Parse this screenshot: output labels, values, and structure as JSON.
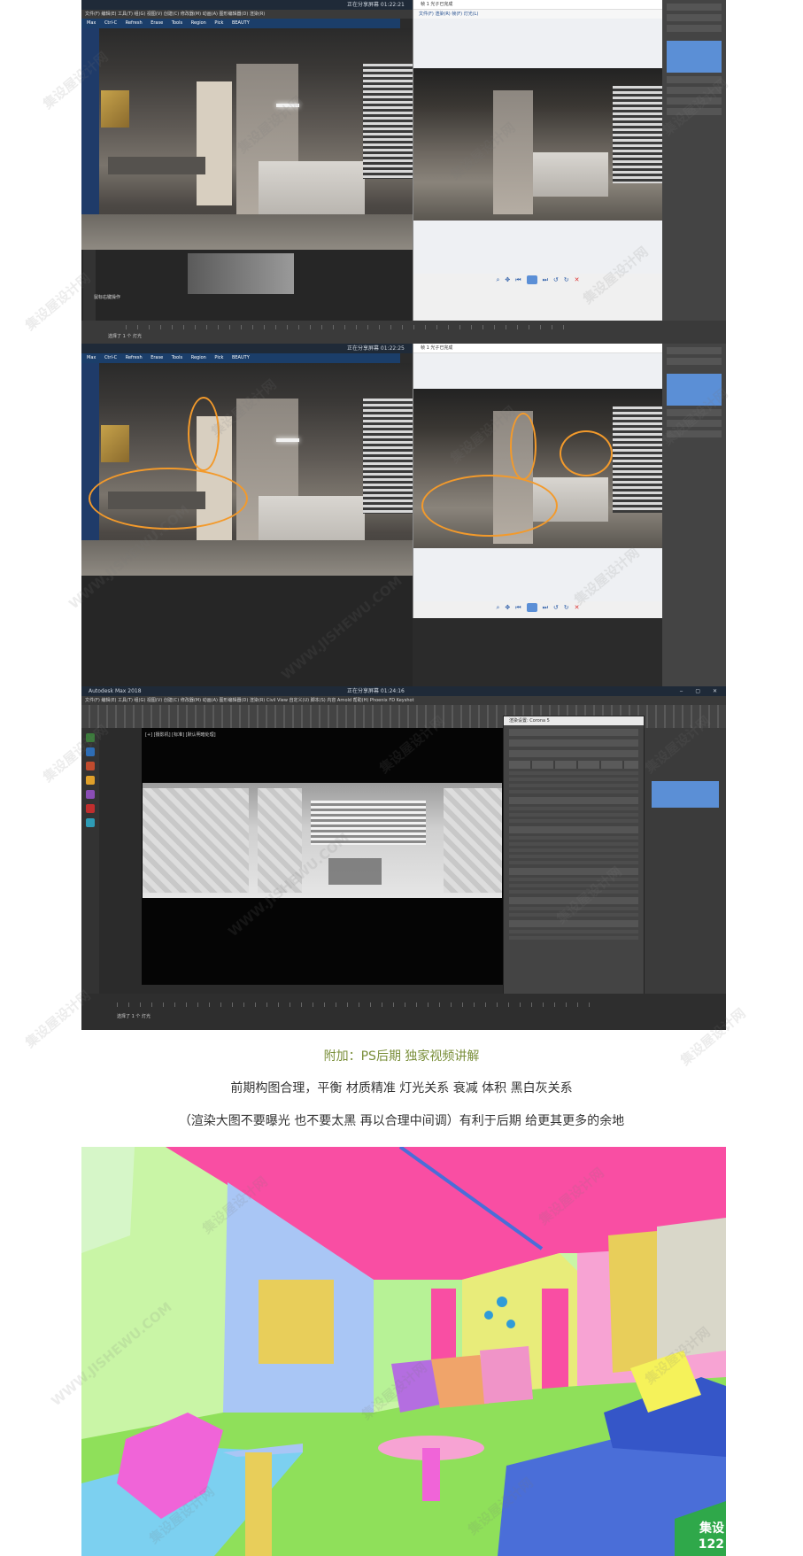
{
  "shot1": {
    "app_title": "",
    "center_status": "正在分享屏幕 01:22:21",
    "render_window_title": "帧 1 光子已完成",
    "menu_items": [
      "Max",
      "Ctrl-C",
      "Refresh",
      "Erase",
      "Tools",
      "Region",
      "Pick",
      "BEAUTY"
    ],
    "render_menu": "文件(F)   渲染(R)   帧(F)   灯光(L)",
    "status_left": "选择了 1 个 灯光",
    "bottom_info": "鼠标右键操作"
  },
  "shot2": {
    "center_status": "正在分享屏幕 01:22:25",
    "render_window_title": "帧 1 光子已完成",
    "menu_items": [
      "Max",
      "Ctrl-C",
      "Refresh",
      "Erase",
      "Tools",
      "Region",
      "Pick",
      "BEAUTY"
    ]
  },
  "shot3": {
    "app_title": "Autodesk Max 2018",
    "center_status": "正在分享屏幕 01:24:16",
    "viewport_label": "[+] [摄影机] [标准] [默认明暗处理]",
    "render_setup_title": "渲染设置: Corona 5",
    "status_left": "选择了 1 个 灯光"
  },
  "captions": {
    "title": "附加：PS后期  独家视频讲解",
    "line1": "前期构图合理，平衡 材质精准 灯光关系 衰减 体积 黑白灰关系",
    "line2": "（渲染大图不要曝光 也不要太黑 再以合理中间调）有利于后期 给更其更多的余地"
  },
  "idmap": {
    "corner_line1": "集设",
    "corner_line2": "122"
  },
  "watermark": "集设屋设计网",
  "watermark_url": "WWW.JISHEWU.COM",
  "colors": {
    "annotation": "#f39a2b",
    "caption_accent": "#7a8f3a",
    "max_blue": "#5b8fd6"
  }
}
